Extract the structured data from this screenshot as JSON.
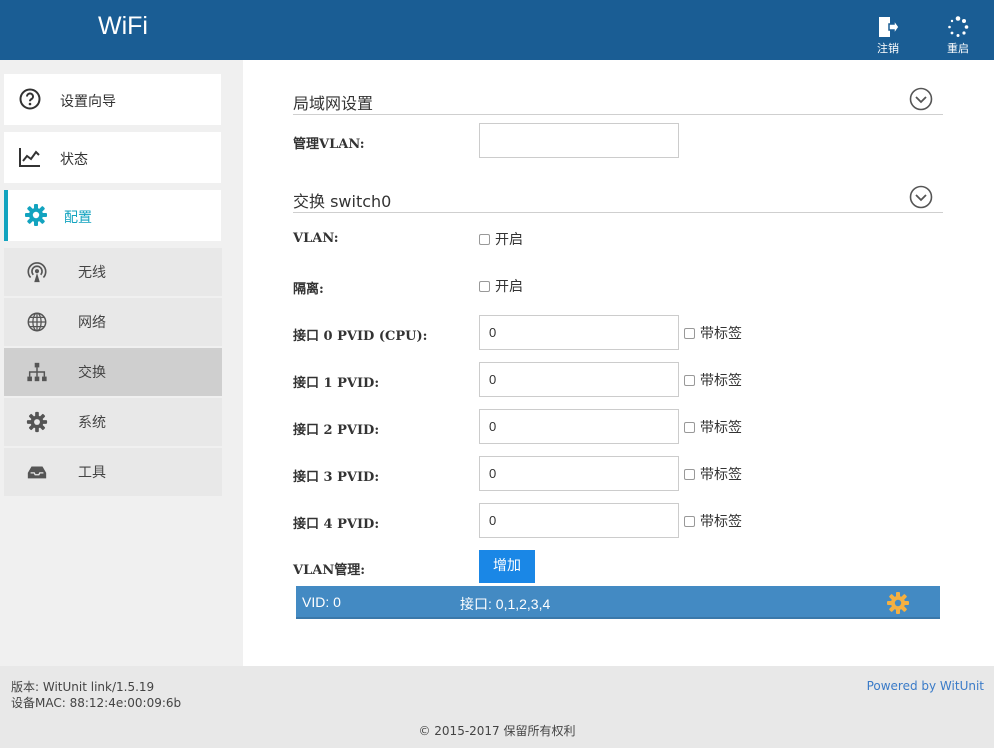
{
  "header": {
    "brand": "WiFi",
    "logout_label": "注销",
    "reboot_label": "重启"
  },
  "sidebar": {
    "main": [
      {
        "label": "设置向导",
        "icon": "question-circle-icon"
      },
      {
        "label": "状态",
        "icon": "line-chart-icon"
      },
      {
        "label": "配置",
        "icon": "gear-icon",
        "active": true
      }
    ],
    "sub": [
      {
        "label": "无线",
        "icon": "wireless-icon"
      },
      {
        "label": "网络",
        "icon": "globe-icon"
      },
      {
        "label": "交换",
        "icon": "sitemap-icon",
        "active": true
      },
      {
        "label": "系统",
        "icon": "gear-icon"
      },
      {
        "label": "工具",
        "icon": "inbox-icon"
      }
    ]
  },
  "lan": {
    "title": "局域网设置",
    "mgmt_vlan_label": "管理VLAN:",
    "mgmt_vlan_value": ""
  },
  "switch": {
    "title": "交换 switch0",
    "vlan_label": "VLAN:",
    "vlan_enable_label": "开启",
    "vlan_enabled": false,
    "isolate_label": "隔离:",
    "isolate_enable_label": "开启",
    "isolate_enabled": false,
    "tag_label": "带标签",
    "ports": [
      {
        "label": "接口 0 PVID (CPU):",
        "value": "0",
        "tagged": false
      },
      {
        "label": "接口 1 PVID:",
        "value": "0",
        "tagged": false
      },
      {
        "label": "接口 2 PVID:",
        "value": "0",
        "tagged": false
      },
      {
        "label": "接口 3 PVID:",
        "value": "0",
        "tagged": false
      },
      {
        "label": "接口 4 PVID:",
        "value": "0",
        "tagged": false
      }
    ],
    "vlan_mgmt_label": "VLAN管理:",
    "add_label": "增加",
    "vlan_rows": [
      {
        "vid": "VID: 0",
        "ports": "接口: 0,1,2,3,4"
      }
    ]
  },
  "footer": {
    "version": "版本: WitUnit link/1.5.19",
    "mac": "设备MAC: 88:12:4e:00:09:6b",
    "powered": "Powered by WitUnit",
    "copyright": "© 2015-2017  保留所有权利"
  },
  "colors": {
    "header_bg": "#1a5d94",
    "accent": "#12a3bf",
    "button": "#1a87e6",
    "vlan_row": "#438ac3",
    "gear_accent": "#f5b041"
  }
}
